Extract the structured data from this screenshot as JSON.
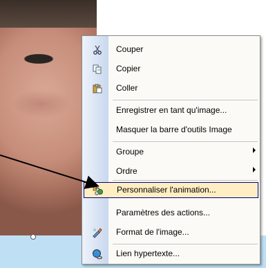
{
  "context_menu": {
    "items": [
      {
        "label": "Couper",
        "icon": "scissors-icon"
      },
      {
        "label": "Copier",
        "icon": "copy-icon"
      },
      {
        "label": "Coller",
        "icon": "paste-icon"
      },
      {
        "label": "Enregistrer en tant qu'image...",
        "icon": ""
      },
      {
        "label": "Masquer la barre d'outils Image",
        "icon": ""
      },
      {
        "label": "Groupe",
        "icon": "",
        "submenu": true
      },
      {
        "label": "Ordre",
        "icon": "",
        "submenu": true
      },
      {
        "label": "Personnaliser l'animation...",
        "icon": "animation-icon",
        "highlighted": true
      },
      {
        "label": "Paramètres des actions...",
        "icon": ""
      },
      {
        "label": "Format de l'image...",
        "icon": "format-image-icon"
      },
      {
        "label": "Lien hypertexte...",
        "icon": "hyperlink-icon"
      }
    ]
  },
  "colors": {
    "highlight_bg": "#ffeec2",
    "highlight_border": "#000080",
    "menu_bg": "#fbfaf6",
    "slide_blue": "#bfe0f4"
  }
}
